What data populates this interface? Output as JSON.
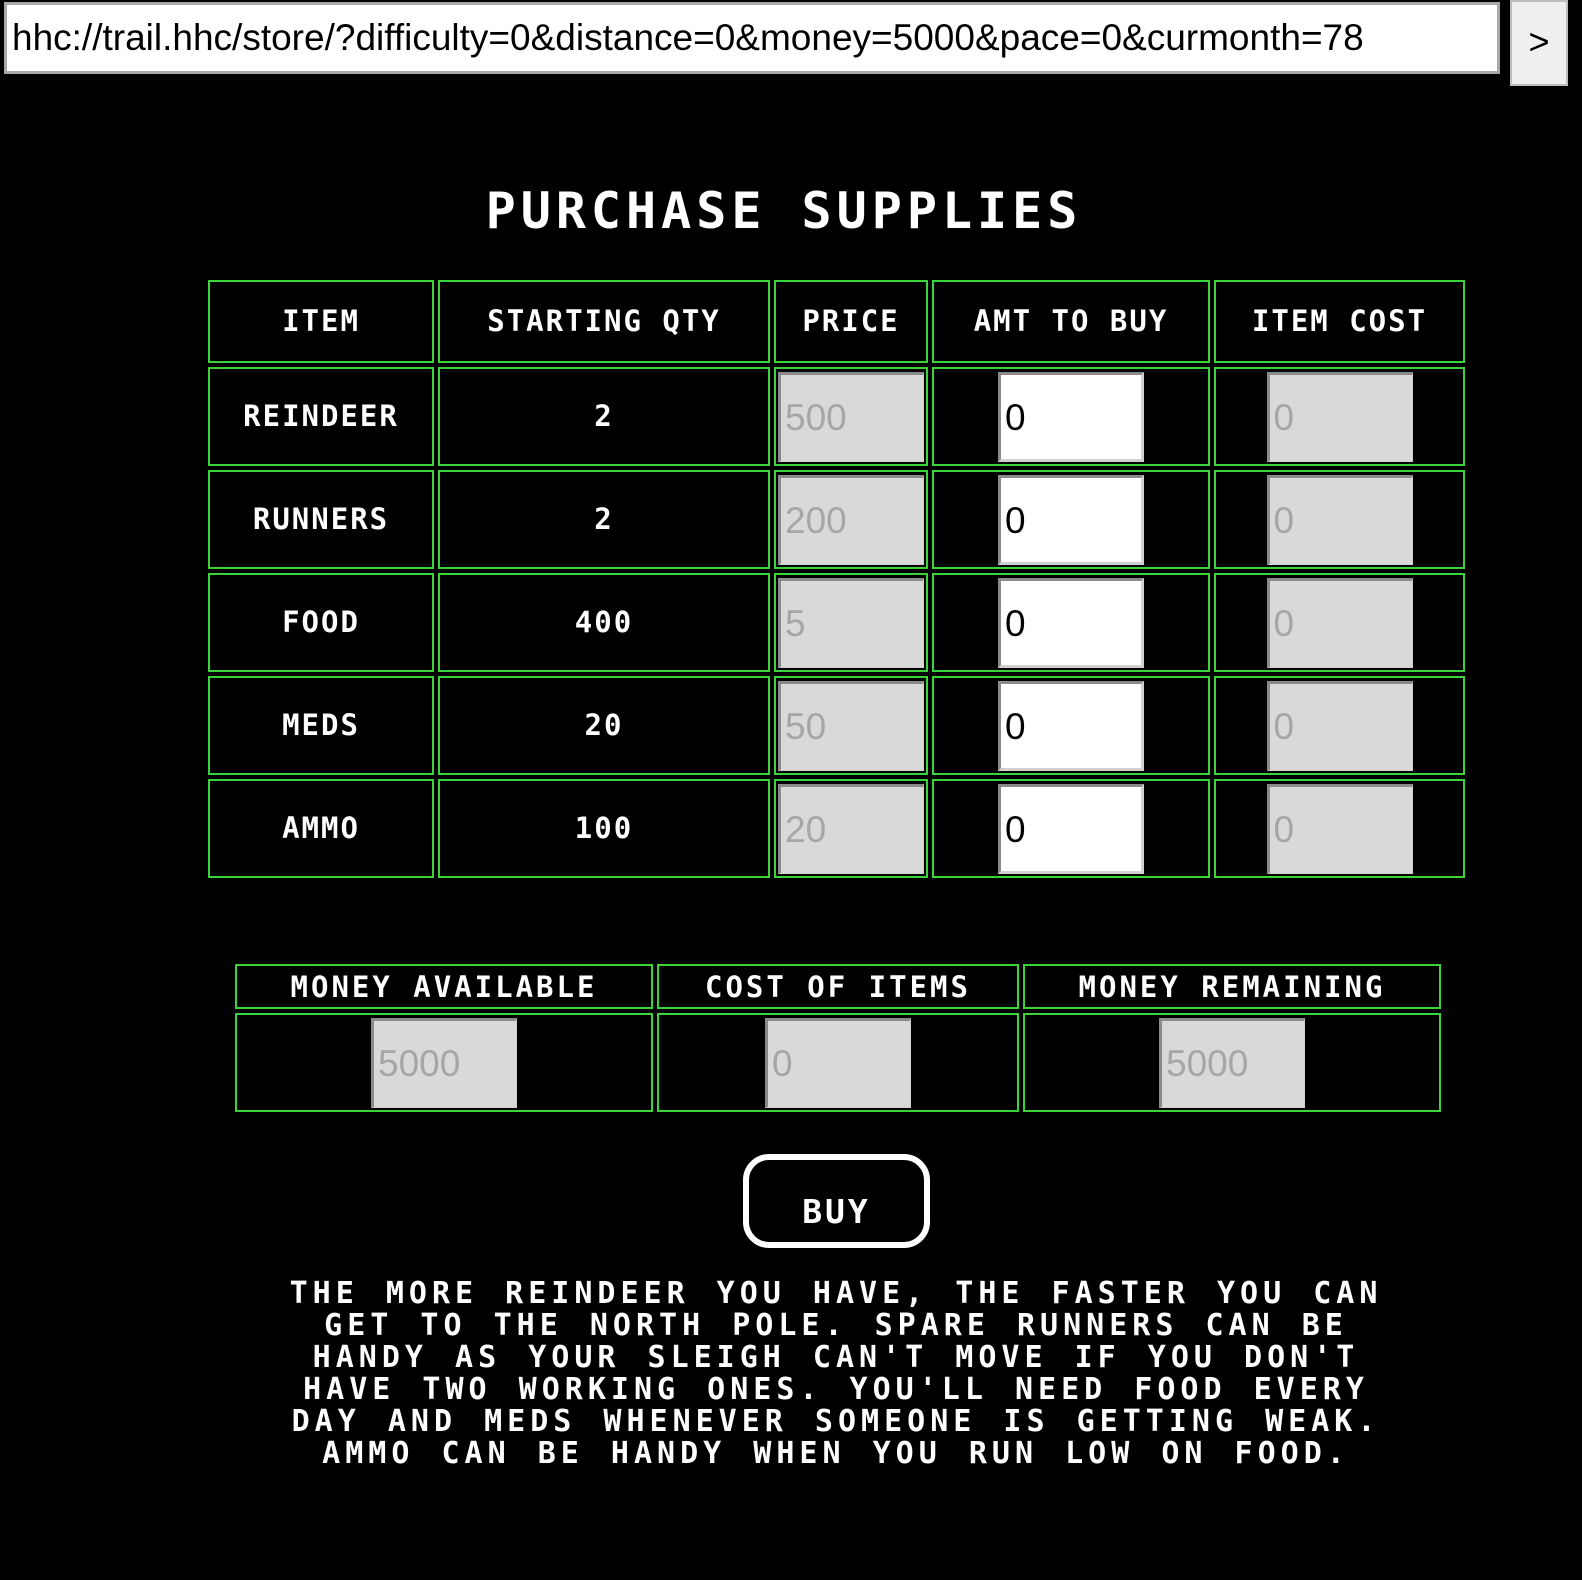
{
  "browser": {
    "url": "hhc://trail.hhc/store/?difficulty=0&distance=0&money=5000&pace=0&curmonth=78",
    "go_label": ">"
  },
  "page": {
    "title": "PURCHASE SUPPLIES"
  },
  "supplies": {
    "headers": {
      "item": "ITEM",
      "starting_qty": "STARTING QTY",
      "price": "PRICE",
      "amt_to_buy": "AMT TO BUY",
      "item_cost": "ITEM COST"
    },
    "rows": [
      {
        "item": "REINDEER",
        "starting_qty": "2",
        "price": "500",
        "amt_to_buy": "0",
        "item_cost": "0"
      },
      {
        "item": "RUNNERS",
        "starting_qty": "2",
        "price": "200",
        "amt_to_buy": "0",
        "item_cost": "0"
      },
      {
        "item": "FOOD",
        "starting_qty": "400",
        "price": "5",
        "amt_to_buy": "0",
        "item_cost": "0"
      },
      {
        "item": "MEDS",
        "starting_qty": "20",
        "price": "50",
        "amt_to_buy": "0",
        "item_cost": "0"
      },
      {
        "item": "AMMO",
        "starting_qty": "100",
        "price": "20",
        "amt_to_buy": "0",
        "item_cost": "0"
      }
    ]
  },
  "summary": {
    "headers": {
      "money_available": "MONEY AVAILABLE",
      "cost_of_items": "COST OF ITEMS",
      "money_remaining": "MONEY REMAINING"
    },
    "money_available": "5000",
    "cost_of_items": "0",
    "money_remaining": "5000"
  },
  "buy_label": "BUY",
  "help_lines": [
    "THE MORE REINDEER YOU HAVE, THE FASTER YOU CAN",
    "GET TO THE NORTH POLE. SPARE RUNNERS CAN BE",
    "HANDY AS YOUR SLEIGH CAN'T MOVE IF YOU DON'T",
    "HAVE TWO WORKING ONES. YOU'LL NEED FOOD EVERY",
    "DAY AND MEDS WHENEVER SOMEONE IS GETTING WEAK.",
    "AMMO CAN BE HANDY WHEN YOU RUN LOW ON FOOD."
  ],
  "colors": {
    "background": "#000000",
    "table_border": "#3ad43a",
    "text": "#ffffff"
  }
}
